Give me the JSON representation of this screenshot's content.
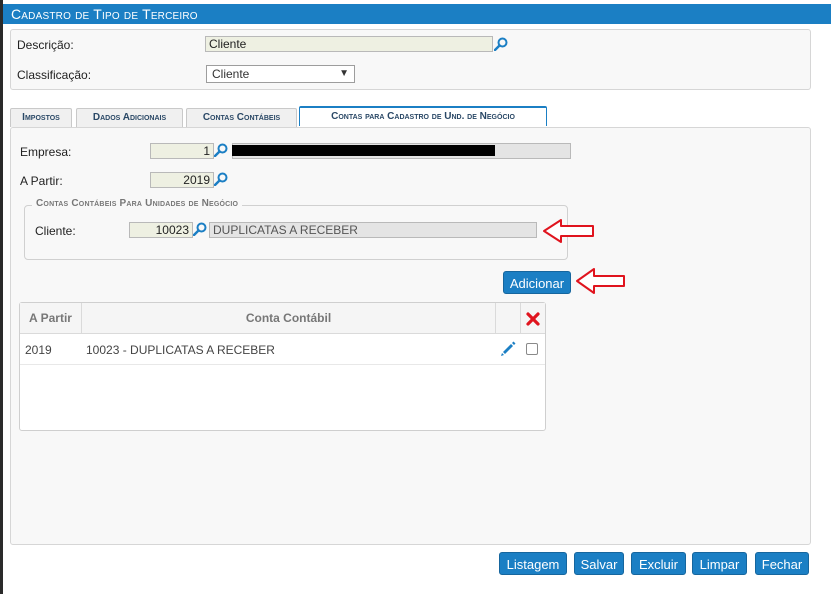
{
  "window": {
    "title": "Cadastro de Tipo de Terceiro"
  },
  "form": {
    "descricao_label": "Descrição:",
    "descricao_value": "Cliente",
    "classificacao_label": "Classificação:",
    "classificacao_value": "Cliente"
  },
  "tabs": [
    {
      "label": "Impostos"
    },
    {
      "label": "Dados Adicionais"
    },
    {
      "label": "Contas Contábeis"
    },
    {
      "label": "Contas para Cadastro de Und. de Negócio"
    }
  ],
  "tab_content": {
    "empresa_label": "Empresa:",
    "empresa_value": "1",
    "apartir_label": "A Partir:",
    "apartir_value": "2019",
    "group_title": "Contas Contábeis Para Unidades de Negócio",
    "cliente_label": "Cliente:",
    "cliente_code": "10023",
    "cliente_desc": "DUPLICATAS A RECEBER",
    "add_label": "Adicionar"
  },
  "table": {
    "columns": [
      "A Partir",
      "Conta Contábil"
    ],
    "rows": [
      {
        "apartir": "2019",
        "conta": "10023 - DUPLICATAS A RECEBER"
      }
    ]
  },
  "footer": {
    "listagem": "Listagem",
    "salvar": "Salvar",
    "excluir": "Excluir",
    "limpar": "Limpar",
    "fechar": "Fechar"
  },
  "icons": {
    "search": "magnifier-icon",
    "edit": "pencil-icon",
    "delete": "red-x-icon",
    "annotation": "red-arrow-icon"
  },
  "colors": {
    "primary": "#1b7fc4",
    "annotation": "#e0141e",
    "input_bg": "#eef0e2"
  }
}
